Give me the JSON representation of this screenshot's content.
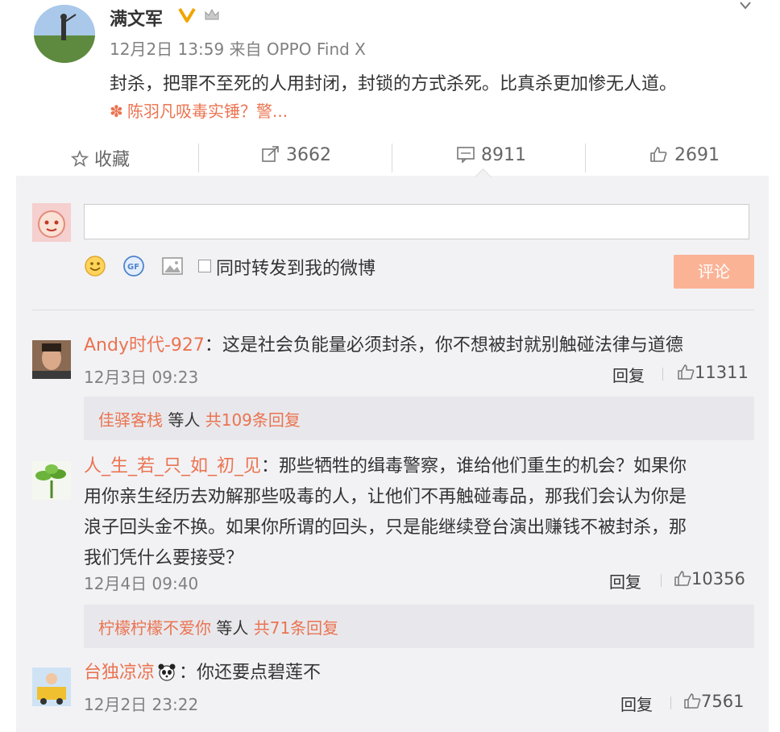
{
  "post": {
    "author": "满文军",
    "meta": "12月2日 13:59 来自 OPPO Find X",
    "text": "封杀，把罪不至死的人用封闭，封锁的方式杀死。比真杀更加惨无人道。",
    "topic": "陈羽凡吸毒实锤？警..."
  },
  "actions": {
    "favorite_label": "收藏",
    "repost_count": "3662",
    "comment_count": "8911",
    "like_count": "2691"
  },
  "composer": {
    "input_value": "",
    "repost_label": "同时转发到我的微博",
    "submit_label": "评论"
  },
  "comments": [
    {
      "user": "Andy时代-927",
      "text_lines": [
        "：这是社会负能量必须封杀，你不想被封就别触碰法律与道德"
      ],
      "date": "12月3日 09:23",
      "reply_label": "回复",
      "likes": "11311",
      "sub": {
        "user": "佳驿客栈",
        "middle": " 等人 ",
        "count_label": "共109条回复"
      }
    },
    {
      "user": "人_生_若_只_如_初_见",
      "text_lines": [
        "：那些牺牲的缉毒警察，谁给他们重生的机会？如果你",
        "用你亲生经历去劝解那些吸毒的人，让他们不再触碰毒品，那我们会认为你是",
        "浪子回头金不换。如果你所谓的回头，只是能继续登台演出赚钱不被封杀，那",
        "我们凭什么要接受？"
      ],
      "date": "12月4日 09:40",
      "reply_label": "回复",
      "likes": "10356",
      "sub": {
        "user": "柠檬柠檬不爱你",
        "middle": " 等人 ",
        "count_label": "共71条回复"
      }
    },
    {
      "user": "台独凉凉",
      "text_lines": [
        "：你还要点碧莲不"
      ],
      "date": "12月2日 23:22",
      "reply_label": "回复",
      "likes": "7561"
    }
  ],
  "colors": {
    "link": "#eb7350",
    "panel": "#f2f2f5",
    "submit": "#fbb396",
    "badge": "#f0a500"
  },
  "icons": [
    "star-icon",
    "repost-icon",
    "comment-icon",
    "like-icon",
    "emoji-icon",
    "gif-icon",
    "image-icon",
    "vip-badge-icon",
    "crown-icon",
    "dropdown-icon",
    "topic-icon"
  ]
}
